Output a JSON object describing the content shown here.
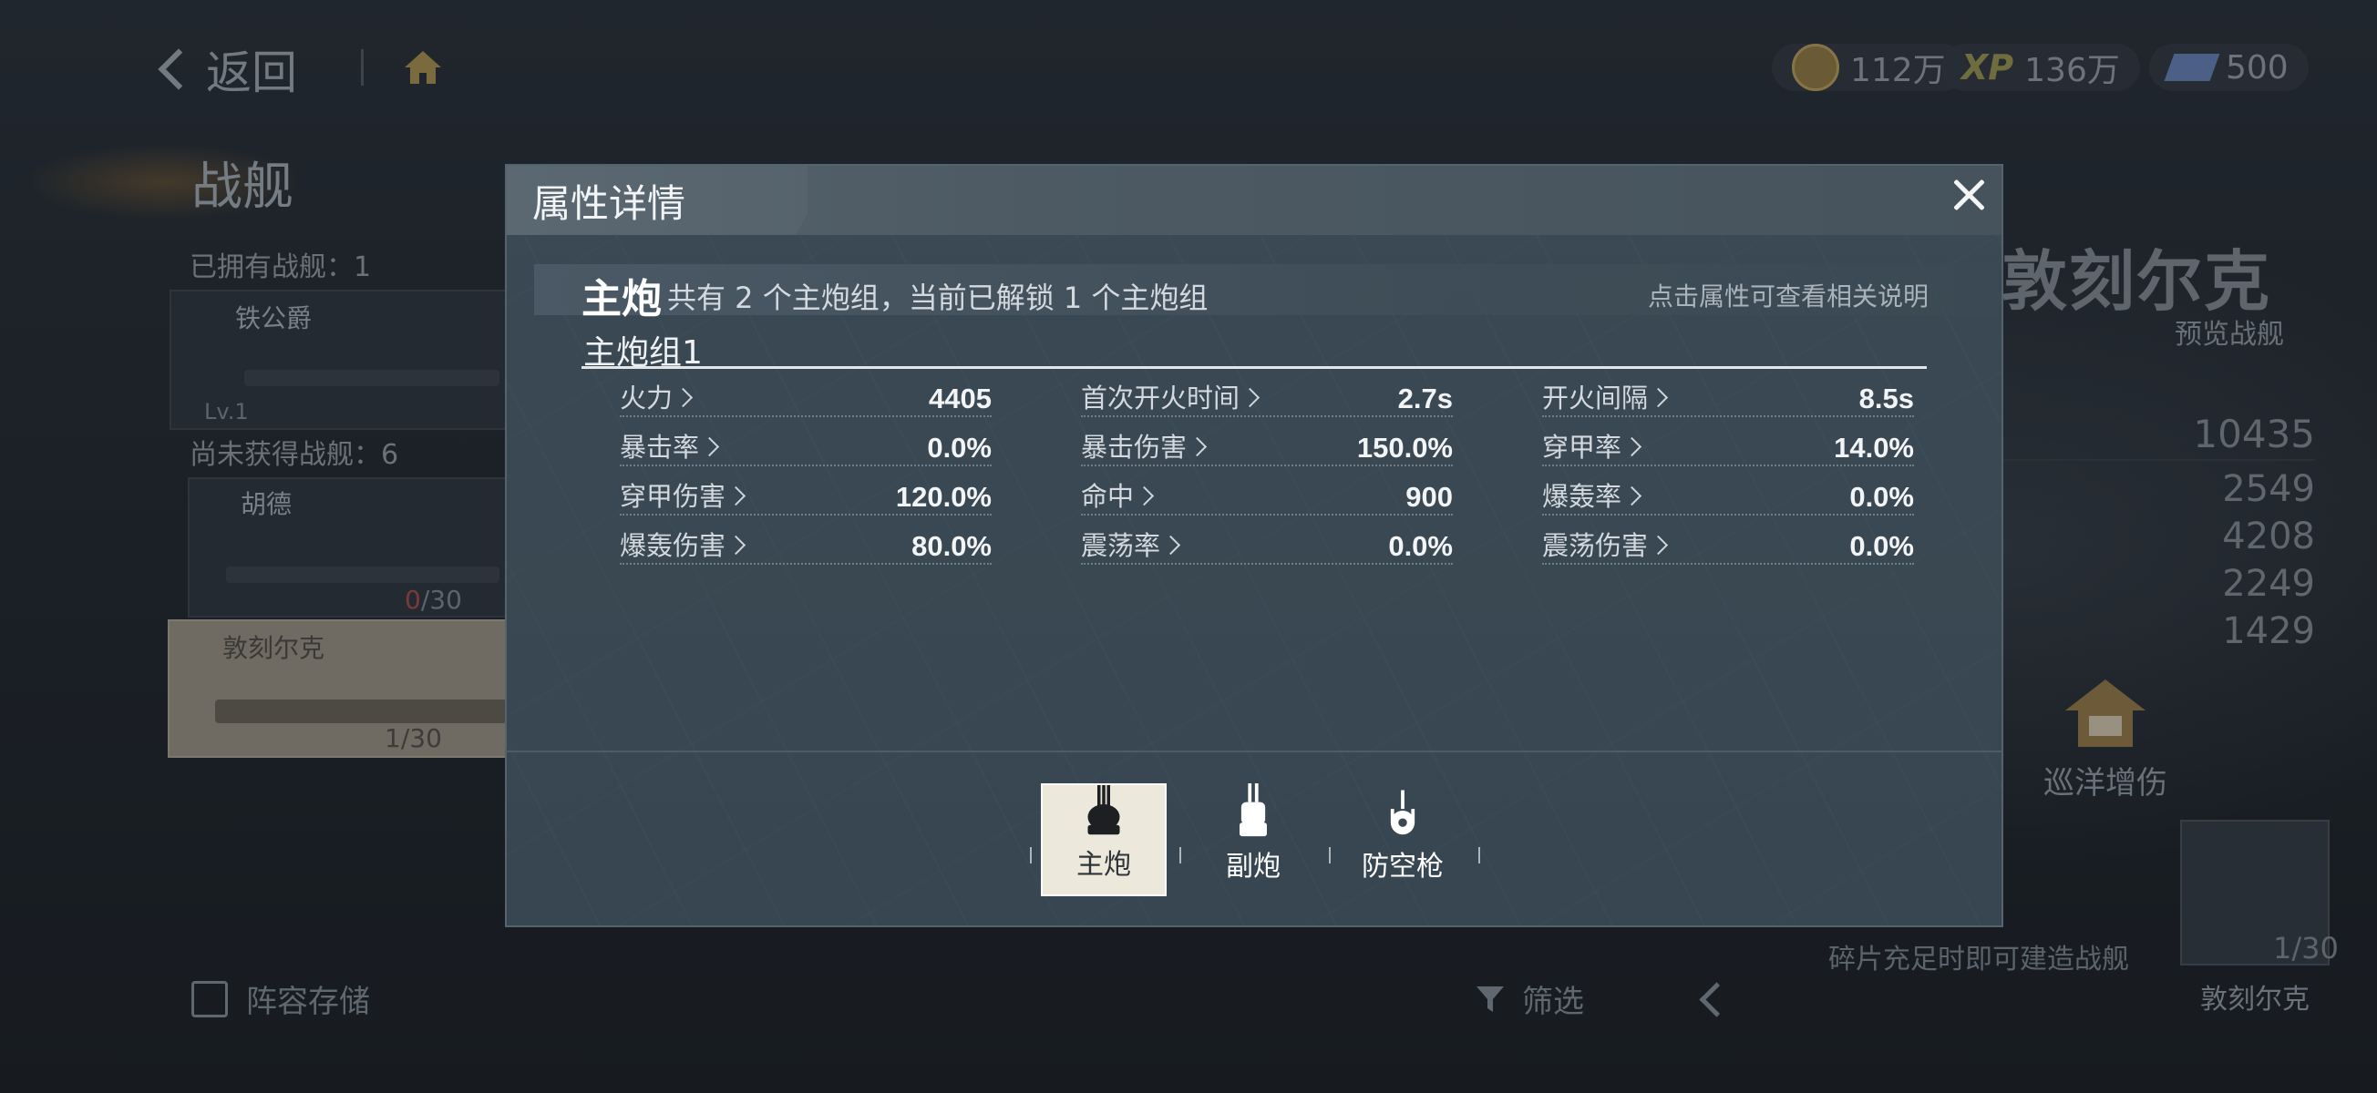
{
  "background": {
    "back_label": "返回",
    "currencies": [
      {
        "icon": "gold-coin-icon",
        "value": "112万"
      },
      {
        "icon": "xp-icon",
        "value": "136万"
      },
      {
        "icon": "ticket-icon",
        "value": "500"
      }
    ],
    "page_title": "战舰",
    "owned_label": "已拥有战舰：1",
    "not_owned_label": "尚未获得战舰：6",
    "ships": [
      {
        "name": "铁公爵",
        "level": "Lv.1"
      },
      {
        "name": "胡德",
        "progress_current": "0",
        "progress_total": "/30"
      },
      {
        "name": "敦刻尔克",
        "progress": "1/30"
      }
    ],
    "right_ship_name": "敦刻尔克",
    "preview_label": "预览战舰",
    "stats": [
      "10435",
      "2549",
      "4208",
      "2249",
      "1429"
    ],
    "cruise_label": "巡洋增伤",
    "fragment_note": "碎片充足时即可建造战舰",
    "thumb_progress": "1/30",
    "thumb_name": "敦刻尔克",
    "save_label": "阵容存储",
    "filter_label": "筛选"
  },
  "modal": {
    "title": "属性详情",
    "category": "主炮",
    "description": "共有 2 个主炮组，当前已解锁 1 个主炮组",
    "hint": "点击属性可查看相关说明",
    "group_title": "主炮组1",
    "attributes": [
      {
        "label": "火力",
        "value": "4405"
      },
      {
        "label": "首次开火时间",
        "value": "2.7s"
      },
      {
        "label": "开火间隔",
        "value": "8.5s"
      },
      {
        "label": "暴击率",
        "value": "0.0%"
      },
      {
        "label": "暴击伤害",
        "value": "150.0%"
      },
      {
        "label": "穿甲率",
        "value": "14.0%"
      },
      {
        "label": "穿甲伤害",
        "value": "120.0%"
      },
      {
        "label": "命中",
        "value": "900"
      },
      {
        "label": "爆轰率",
        "value": "0.0%"
      },
      {
        "label": "爆轰伤害",
        "value": "80.0%"
      },
      {
        "label": "震荡率",
        "value": "0.0%"
      },
      {
        "label": "震荡伤害",
        "value": "0.0%"
      }
    ],
    "tabs": [
      {
        "label": "主炮",
        "icon": "main-gun-icon",
        "active": true
      },
      {
        "label": "副炮",
        "icon": "secondary-gun-icon",
        "active": false
      },
      {
        "label": "防空枪",
        "icon": "anti-air-gun-icon",
        "active": false
      }
    ]
  },
  "colors": {
    "modal_bg": "#3a4853",
    "modal_header": "#4d5a64",
    "active_tab_bg": "#ece8dc",
    "screen_bg": "#1b2128"
  }
}
